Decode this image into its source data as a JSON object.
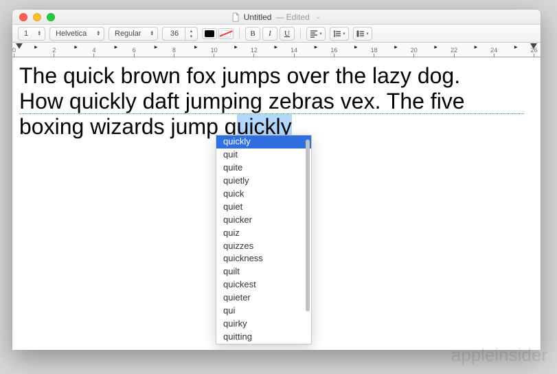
{
  "window": {
    "title": "Untitled",
    "status": "Edited"
  },
  "toolbar": {
    "paragraph_style": "1",
    "font_family": "Helvetica",
    "font_style": "Regular",
    "font_size": "36",
    "bold_label": "B",
    "italic_label": "I",
    "underline_label": "U"
  },
  "ruler": {
    "tick_values": [
      "0",
      "2",
      "4",
      "6",
      "8",
      "10",
      "12",
      "14",
      "16",
      "18",
      "20",
      "22",
      "24",
      "26"
    ]
  },
  "document": {
    "line1": "The quick brown fox jumps over the lazy dog.",
    "line2": "How quickly daft jumping zebras vex. The five",
    "line3_before_sel": "boxing wizards jump q",
    "line3_sel": "uickly"
  },
  "autocomplete": {
    "selected_index": 0,
    "items": [
      "quickly",
      "quit",
      "quite",
      "quietly",
      "quick",
      "quiet",
      "quicker",
      "quiz",
      "quizzes",
      "quickness",
      "quilt",
      "quickest",
      "quieter",
      "qui",
      "quirky",
      "quitting"
    ]
  },
  "watermark": "appleinsider"
}
